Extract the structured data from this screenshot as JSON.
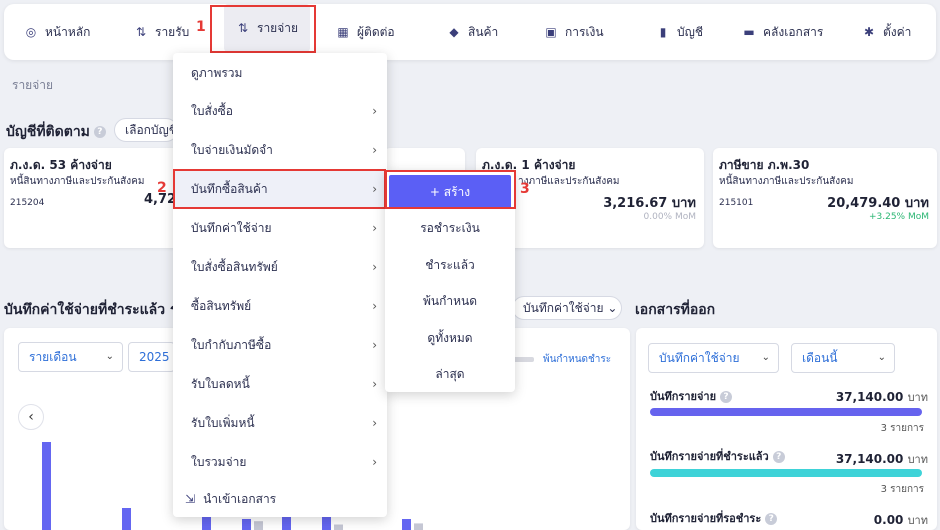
{
  "nav": {
    "items": [
      {
        "label": "หน้าหลัก",
        "icon": "dashboard-icon"
      },
      {
        "label": "รายรับ",
        "icon": "sort-icon"
      },
      {
        "label": "รายจ่าย",
        "icon": "sort-icon"
      },
      {
        "label": "ผู้ติดต่อ",
        "icon": "contacts-icon"
      },
      {
        "label": "สินค้า",
        "icon": "box-icon"
      },
      {
        "label": "การเงิน",
        "icon": "money-icon"
      },
      {
        "label": "บัญชี",
        "icon": "book-icon"
      },
      {
        "label": "คลังเอกสาร",
        "icon": "folder-icon"
      },
      {
        "label": "ตั้งค่า",
        "icon": "gear-icon"
      }
    ]
  },
  "annotations": {
    "n1": "1",
    "n2": "2",
    "n3": "3"
  },
  "breadcrumb": "รายจ่าย",
  "tracked": {
    "title": "บัญชีที่ติดตาม",
    "select_label": "เลือกบัญชี",
    "cards": [
      {
        "title": "ภ.ง.ด. 53 ค้างจ่าย",
        "subtitle": "หนี้สินทางภาษีและประกันสังคม",
        "code": "215204",
        "amount": "4,72",
        "mom": ""
      },
      {
        "title": "ภ.ง.ด. 1 ค้างจ่าย",
        "subtitle": "างภาษีและประกันสังคม",
        "code": "",
        "amount": "3,216.67 บาท",
        "mom": "0.00% MoM"
      },
      {
        "title": "ภาษีขาย ภ.พ.30",
        "subtitle": "หนี้สินทางภาษีและประกันสังคม",
        "code": "215101",
        "amount": "20,479.40 บาท",
        "mom": "+3.25% MoM"
      }
    ]
  },
  "expenses": {
    "title": "บันทึกค่าใช้จ่ายที่ชำระแล้ว รอชำ",
    "type_select": "บันทึกค่าใช้จ่าย",
    "period_select": "รายเดือน",
    "year_select": "2025",
    "legend_overdue": "พ้นกำหนดชำระ"
  },
  "menu": {
    "items": [
      {
        "label": "ดูภาพรวม",
        "has_sub": false
      },
      {
        "label": "ใบสั่งซื้อ",
        "has_sub": true
      },
      {
        "label": "ใบจ่ายเงินมัดจำ",
        "has_sub": true
      },
      {
        "label": "บันทึกซื้อสินค้า",
        "has_sub": true
      },
      {
        "label": "บันทึกค่าใช้จ่าย",
        "has_sub": true
      },
      {
        "label": "ใบสั่งซื้อสินทรัพย์",
        "has_sub": true
      },
      {
        "label": "ซื้อสินทรัพย์",
        "has_sub": true
      },
      {
        "label": "ใบกำกับภาษีซื้อ",
        "has_sub": true
      },
      {
        "label": "รับใบลดหนี้",
        "has_sub": true
      },
      {
        "label": "รับใบเพิ่มหนี้",
        "has_sub": true
      },
      {
        "label": "ใบรวมจ่าย",
        "has_sub": true
      }
    ],
    "import_label": "นำเข้าเอกสาร"
  },
  "submenu": {
    "create": "+ สร้าง",
    "items": [
      "รอชำระเงิน",
      "ชำระแล้ว",
      "พ้นกำหนด",
      "ดูทั้งหมด",
      "ล่าสุด"
    ]
  },
  "docs": {
    "title": "เอกสารที่ออก",
    "type_select": "บันทึกค่าใช้จ่าย",
    "period_select": "เดือนนี้",
    "metrics": [
      {
        "label": "บันทึกรายจ่าย",
        "value": "37,140.00",
        "unit": "บาท",
        "count": "3 รายการ",
        "color": "#6663ee"
      },
      {
        "label": "บันทึกรายจ่ายที่ชำระแล้ว",
        "value": "37,140.00",
        "unit": "บาท",
        "count": "3 รายการ",
        "color": "#3ed3d8"
      },
      {
        "label": "บันทึกรายจ่ายที่รอชำระ",
        "value": "0.00",
        "unit": "บาท",
        "count": "",
        "color": "#ccc"
      }
    ]
  },
  "chart_data": {
    "type": "bar",
    "series": [
      {
        "values": [
          0.8,
          0,
          0.2,
          0,
          0.15,
          0.1,
          0.12,
          0.5,
          0,
          0.1
        ]
      },
      {
        "values": [
          0,
          0,
          0,
          0,
          0,
          0.08,
          0,
          0.05,
          0,
          0.06
        ]
      }
    ],
    "colors": [
      "#6466f1",
      "#c5c7d4"
    ]
  }
}
